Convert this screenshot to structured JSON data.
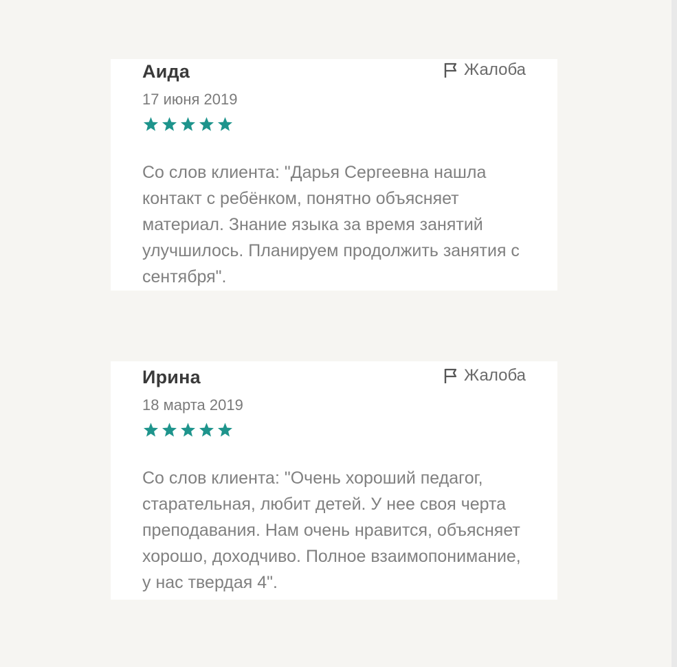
{
  "reviews": [
    {
      "author": "Аида",
      "date": "17 июня 2019",
      "rating": 5,
      "complaint_label": "Жалоба",
      "text": "Со слов клиента: \"Дарья Сергеевна нашла контакт с ребёнком, понятно объясняет материал. Знание языка за время занятий улучшилось. Планируем продолжить занятия с сентября\"."
    },
    {
      "author": "Ирина",
      "date": "18 марта 2019",
      "rating": 5,
      "complaint_label": "Жалоба",
      "text": "Со слов клиента: \"Очень хороший педагог, старательная, любит детей. У нее своя черта преподавания. Нам очень нравится, объясняет хорошо, доходчиво. Полное взаимопонимание, у нас твердая 4\"."
    }
  ],
  "colors": {
    "star": "#1e948c",
    "page_background": "#f6f5f2",
    "card_background": "#ffffff"
  },
  "icons": {
    "complaint": "flag-icon",
    "rating": "star-icon"
  }
}
